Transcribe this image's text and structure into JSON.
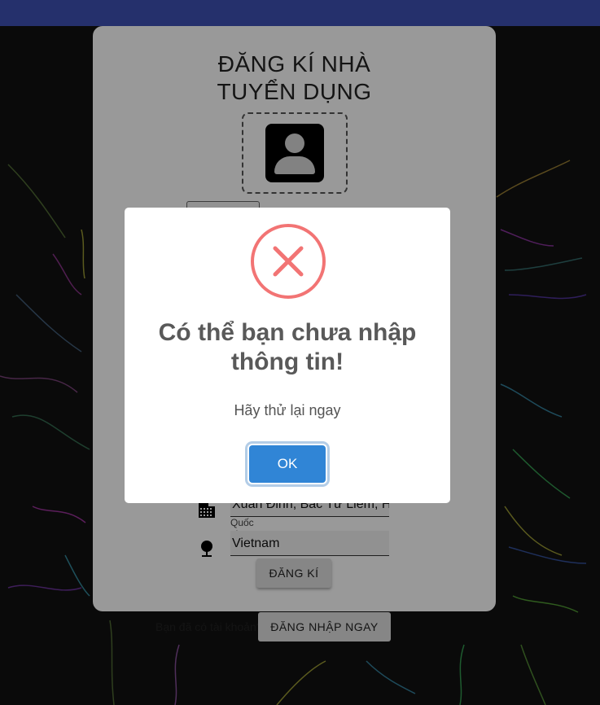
{
  "form": {
    "title_line1": "ĐĂNG KÍ NHÀ",
    "title_line2": "TUYỂN DỤNG",
    "address_value": "Xuân Đỉnh, Bắc Từ Liêm, Hà Nội",
    "country_label": "Quốc gia",
    "country_value": "Vietnam",
    "register_label": "ĐĂNG KÍ"
  },
  "footer": {
    "has_account_text": "Bạn đã có tài khoản?",
    "login_label": "ĐĂNG NHẬP NGAY"
  },
  "dialog": {
    "icon": "error-x-icon",
    "title_line1": "Có thể bạn chưa nhập",
    "title_line2": "thông tin!",
    "message": "Hãy thử lại ngay",
    "ok_label": "OK"
  },
  "colors": {
    "appbar": "#3f51b5",
    "error": "#f27474",
    "confirm": "#3085d6"
  }
}
